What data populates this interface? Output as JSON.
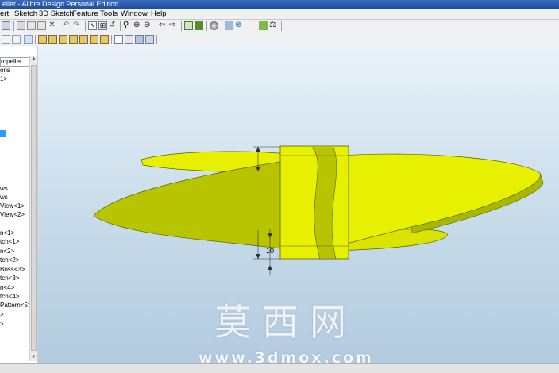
{
  "window": {
    "title": "eller - Alibre Design Personal Edition"
  },
  "menu": [
    "ert",
    "Sketch",
    "3D Sketch",
    "Feature",
    "Tools",
    "Window",
    "Help"
  ],
  "tree": {
    "root": "ropeller",
    "nodes": [
      "ons",
      "1>",
      "",
      "",
      "",
      "",
      "",
      "ws",
      "ws",
      "View<1>",
      "View<2>",
      "",
      "n<1>",
      "tch<1>",
      "n<2>",
      "tch<2>",
      "Boss<3>",
      "tch<3>",
      "n<4>",
      "tch<4>",
      "Pattern<5>",
      ">",
      ">"
    ],
    "selected_index": 5
  },
  "dimension": {
    "value": "10"
  },
  "watermark": {
    "chinese": "莫西网",
    "url": "www.3dmox.com"
  },
  "colors": {
    "part_face": "#e6f000",
    "part_shade": "#a8b800",
    "viewport_top": "#e9f2f9",
    "viewport_bottom": "#b3cbe0"
  }
}
